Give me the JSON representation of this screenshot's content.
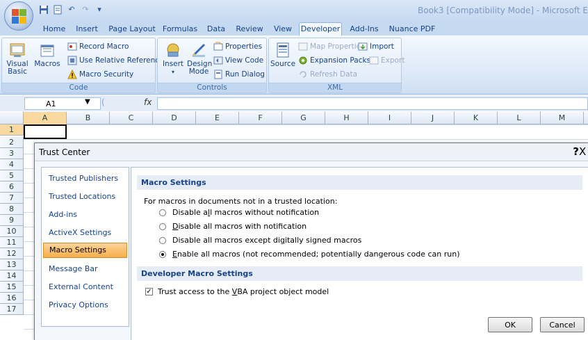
{
  "window": {
    "title": "Book3  [Compatibility Mode] - Microsoft E"
  },
  "quick_access": {
    "save_icon": "save-icon",
    "print_preview_icon": "sheet-icon",
    "undo_icon": "undo-icon",
    "redo_icon": "redo-icon",
    "customize_icon": "dropdown-icon"
  },
  "tabs": [
    {
      "label": "Home"
    },
    {
      "label": "Insert"
    },
    {
      "label": "Page Layout"
    },
    {
      "label": "Formulas"
    },
    {
      "label": "Data"
    },
    {
      "label": "Review"
    },
    {
      "label": "View"
    },
    {
      "label": "Developer",
      "active": true
    },
    {
      "label": "Add-Ins"
    },
    {
      "label": "Nuance PDF"
    }
  ],
  "ribbon": {
    "code": {
      "label": "Code",
      "visual_basic": "Visual\nBasic",
      "macros": "Macros",
      "record_macro": "Record Macro",
      "use_relative_references": "Use Relative References",
      "macro_security": "Macro Security"
    },
    "controls": {
      "label": "Controls",
      "insert": "Insert",
      "design_mode": "Design\nMode",
      "properties": "Properties",
      "view_code": "View Code",
      "run_dialog": "Run Dialog"
    },
    "xml": {
      "label": "XML",
      "source": "Source",
      "map_properties": "Map Properties",
      "import": "Import",
      "expansion_packs": "Expansion Packs",
      "export": "Export",
      "refresh_data": "Refresh Data"
    }
  },
  "formula_bar": {
    "name_box": "A1",
    "fx": "fx",
    "value": ""
  },
  "grid": {
    "columns": [
      "A",
      "B",
      "C",
      "D",
      "E",
      "F",
      "G",
      "H",
      "I",
      "J",
      "K",
      "L",
      "M"
    ],
    "rows": [
      "1",
      "2",
      "3",
      "4",
      "5",
      "6",
      "7",
      "8",
      "9",
      "10",
      "11",
      "12",
      "13",
      "14",
      "15",
      "16",
      "17"
    ],
    "active_cell": "A1"
  },
  "dialog": {
    "title": "Trust Center",
    "help": "?",
    "close": "X",
    "nav": [
      "Trusted Publishers",
      "Trusted Locations",
      "Add-ins",
      "ActiveX Settings",
      "Macro Settings",
      "Message Bar",
      "External Content",
      "Privacy Options"
    ],
    "active_nav": "Macro Settings",
    "macro_settings": {
      "heading": "Macro Settings",
      "prompt": "For macros in documents not in a trusted location:",
      "options": [
        {
          "pre": "Disable a",
          "u": "l",
          "post": "l macros without notification",
          "selected": false
        },
        {
          "pre": "",
          "u": "D",
          "post": "isable all macros with notification",
          "selected": false
        },
        {
          "pre": "Disable all macros except di",
          "u": "g",
          "post": "itally signed macros",
          "selected": false
        },
        {
          "pre": "",
          "u": "E",
          "post": "nable all macros (not recommended; potentially dangerous code can run)",
          "selected": true
        }
      ]
    },
    "developer_settings": {
      "heading": "Developer Macro Settings",
      "trust_vba_pre": "Trust access to the ",
      "trust_vba_u": "V",
      "trust_vba_post": "BA project object model",
      "trust_vba_checked": true
    },
    "buttons": {
      "ok": "OK",
      "cancel": "Cancel"
    }
  }
}
